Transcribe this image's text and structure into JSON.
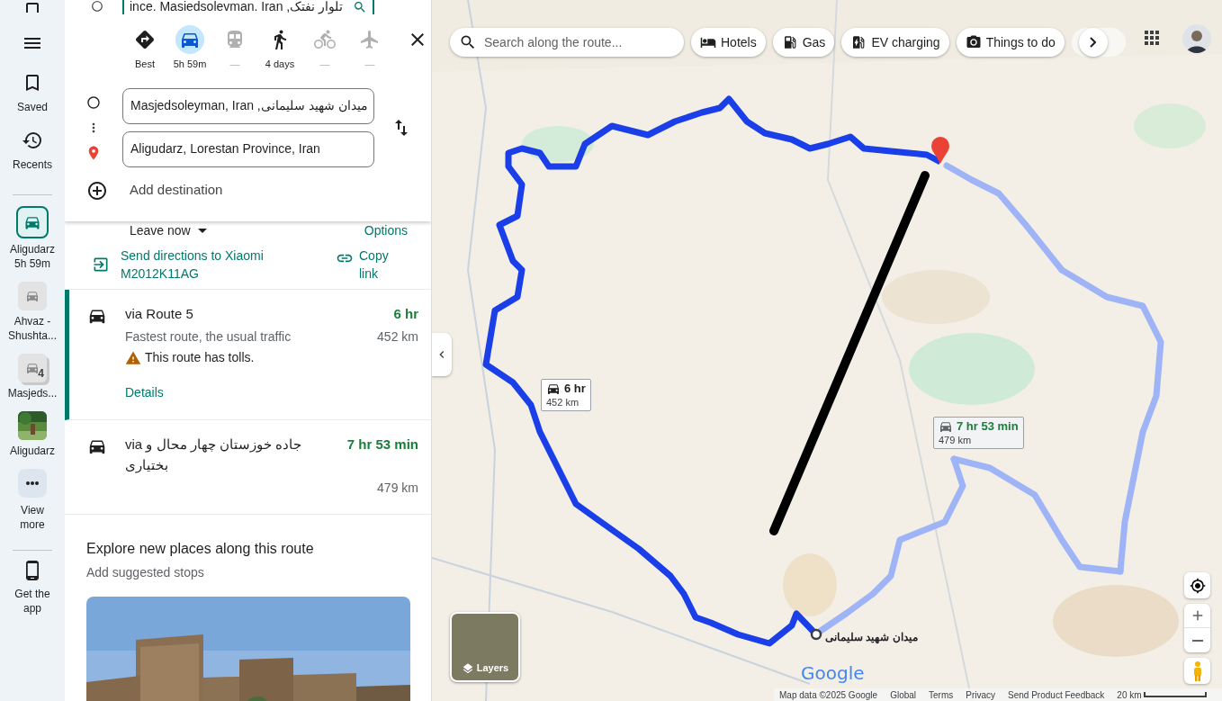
{
  "top_field": {
    "value": "ince. Masiedsolevman. Iran ,تلوار نفتک"
  },
  "rail": {
    "items": [
      {
        "kind": "saved",
        "label": "Saved"
      },
      {
        "kind": "recents",
        "label": "Recents"
      }
    ],
    "recent": [
      {
        "kind": "directions",
        "label": "Aligudarz",
        "sublabel": "5h 59m",
        "selected": true
      },
      {
        "kind": "thumb",
        "label": "Ahvaz - Shushta...",
        "selected": false
      },
      {
        "kind": "thumb_count",
        "label": "Masjeds...",
        "badge": "4",
        "selected": false
      },
      {
        "label": "Aligudarz",
        "selected": false
      }
    ],
    "more": {
      "label": "View more"
    },
    "get_app": {
      "label": "Get the app"
    }
  },
  "modes": [
    {
      "kind": "best",
      "label": "Best",
      "selected": false,
      "disabled": false
    },
    {
      "kind": "drive",
      "label": "5h 59m",
      "selected": true,
      "disabled": false
    },
    {
      "kind": "transit",
      "label": "—",
      "selected": false,
      "disabled": true
    },
    {
      "kind": "walk",
      "label": "4 days",
      "selected": false,
      "disabled": false
    },
    {
      "kind": "bike",
      "label": "—",
      "selected": false,
      "disabled": true
    },
    {
      "kind": "flight",
      "label": "—",
      "selected": false,
      "disabled": true
    }
  ],
  "stops": [
    {
      "kind": "origin",
      "value": "Masjedsoleyman, Iran ,میدان شهید سلیمانی"
    },
    {
      "kind": "destination",
      "value": "Aligudarz, Lorestan Province, Iran"
    }
  ],
  "add_destination": "Add destination",
  "leave": "Leave now",
  "options": "Options",
  "send": "Send directions to Xiaomi M2012K11AG",
  "copy": "Copy link",
  "routes": [
    {
      "via": "via Route 5",
      "description": "Fastest route, the usual traffic",
      "warning": "This route has tolls.",
      "details": "Details",
      "duration": "6 hr",
      "distance": "452 km",
      "selected": true
    },
    {
      "via": "via جاده خوزستان چهار محال و بختیاری",
      "duration": "7 hr 53 min",
      "distance": "479 km",
      "selected": false
    }
  ],
  "explore": {
    "title": "Explore new places along this route",
    "subtitle": "Add suggested stops"
  },
  "map": {
    "search_placeholder": "Search along the route...",
    "chips": [
      {
        "kind": "hotel",
        "label": "Hotels"
      },
      {
        "kind": "gas",
        "label": "Gas"
      },
      {
        "kind": "ev",
        "label": "EV charging"
      },
      {
        "kind": "camera",
        "label": "Things to do"
      }
    ],
    "callouts": [
      {
        "duration": "6 hr",
        "distance": "452 km",
        "selected": true
      },
      {
        "duration": "7 hr 53 min",
        "distance": "479 km",
        "selected": false
      }
    ],
    "origin_label": "میدان شهید سلیمانی",
    "layers": "Layers",
    "logo": "Google",
    "footer": [
      "Map data ©2025 Google",
      "Global",
      "Terms",
      "Privacy",
      "Send Product Feedback"
    ],
    "scale": "20 km"
  }
}
